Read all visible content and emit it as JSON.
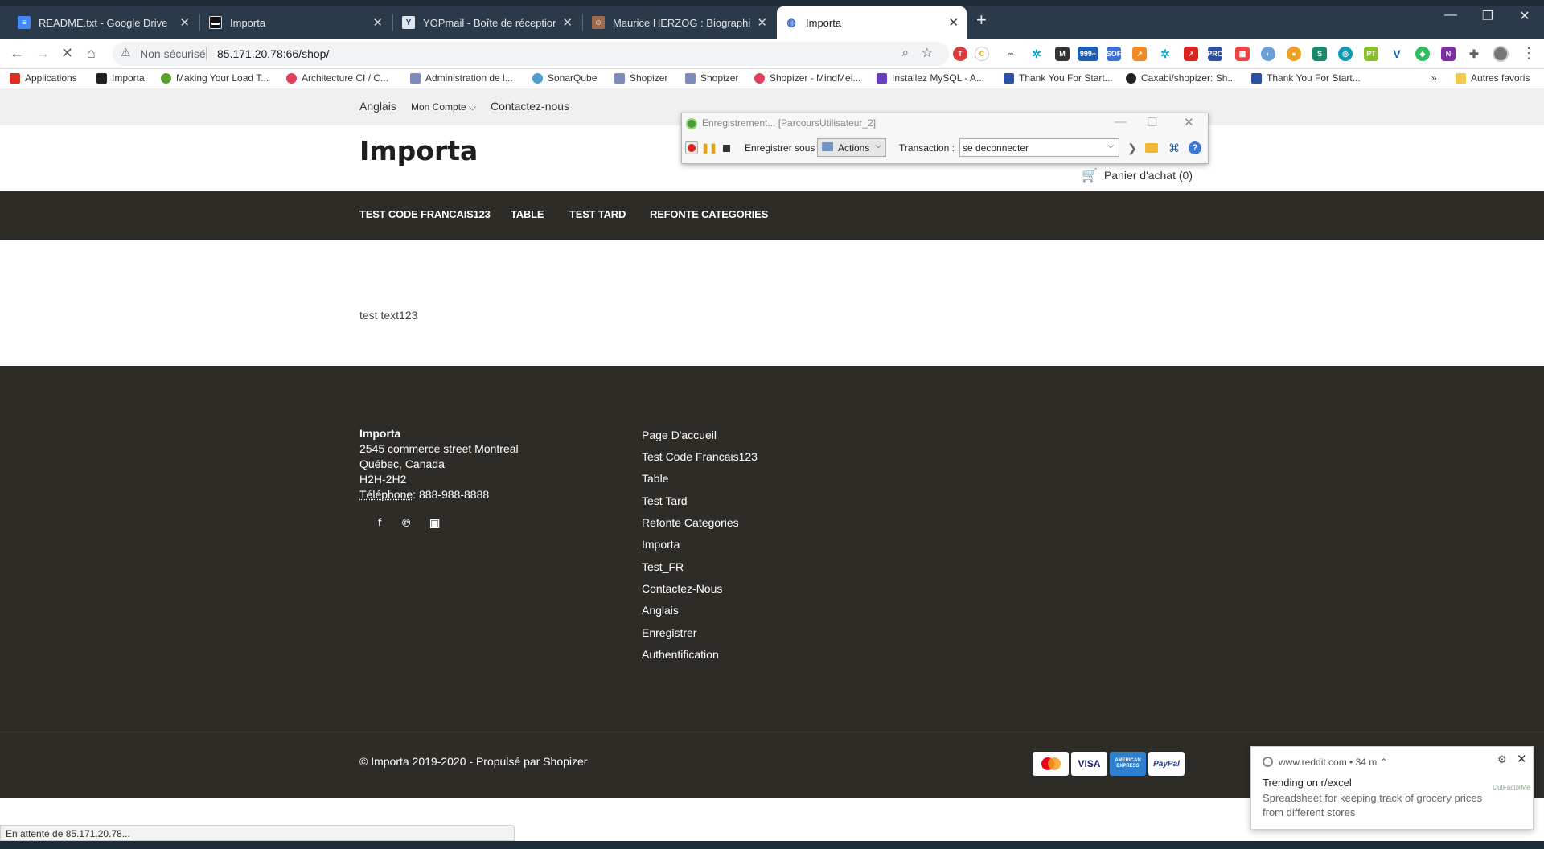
{
  "browser": {
    "tabs": [
      {
        "title": "README.txt - Google Drive",
        "favicon": "google-docs-icon",
        "active": false
      },
      {
        "title": "Importa",
        "favicon": "importa-icon",
        "active": false
      },
      {
        "title": "YOPmail - Boîte de réception",
        "favicon": "yopmail-icon",
        "active": false
      },
      {
        "title": "Maurice HERZOG : Biographie, Tom",
        "favicon": "portrait-icon",
        "active": false
      },
      {
        "title": "Importa",
        "favicon": "importa-icon",
        "active": true
      }
    ],
    "address": {
      "security": "Non sécurisé",
      "url": "85.171.20.78:66/shop/"
    },
    "bookmarks": [
      "Applications",
      "Importa",
      "Making Your Load T...",
      "Architecture CI / C...",
      "Administration de l...",
      "SonarQube",
      "Shopizer",
      "Shopizer",
      "Shopizer - MindMei...",
      "Installez MySQL - A...",
      "Thank You For Start...",
      "Caxabi/shopizer: Sh...",
      "Thank You For Start..."
    ],
    "bookmarks_more": "»",
    "other_favorites": "Autres favoris",
    "status": "En attente de 85.171.20.78..."
  },
  "recorder": {
    "title": "Enregistrement... [ParcoursUtilisateur_2]",
    "save_as_label": "Enregistrer sous :",
    "actions_label": "Actions",
    "transaction_label": "Transaction :",
    "transaction_value": "se deconnecter"
  },
  "site": {
    "topbar": {
      "language": "Anglais",
      "account": "Mon Compte",
      "account_caret": "⌵",
      "contact": "Contactez-nous"
    },
    "logo": "Importa",
    "cart": "Panier d'achat (0)",
    "categories": [
      "TEST CODE FRANCAIS123",
      "TABLE",
      "TEST TARD",
      "REFONTE CATEGORIES"
    ],
    "content_text": "test text123",
    "footer": {
      "company": "Importa",
      "address1": "2545 commerce street Montreal",
      "address2": "Québec, Canada",
      "postal": "H2H-2H2",
      "phone_label": "Téléphone",
      "phone": ": 888-988-8888",
      "links": [
        "Page D'accueil",
        "Test Code Francais123",
        "Table",
        "Test Tard",
        "Refonte Categories",
        "Importa",
        "Test_FR",
        "Contactez-Nous",
        "Anglais",
        "Enregistrer",
        "Authentification"
      ],
      "copyright": "© Importa 2019-2020 - Propulsé par Shopizer",
      "payments": [
        "mastercard",
        "VISA",
        "AMERICAN EXPRESS",
        "PayPal"
      ]
    }
  },
  "notification": {
    "source": "www.reddit.com",
    "age": "• 34 m ⌃",
    "title": "Trending on r/excel",
    "body": "Spreadsheet for keeping track of grocery prices from different stores",
    "logo_text": "OutFactorMe"
  },
  "colors": {
    "footer_bg": "#2e2c27",
    "catnav_bg": "#2e2c27",
    "topbar_bg": "#f0f0f0",
    "tabstrip_bg": "#2b3a4a"
  }
}
